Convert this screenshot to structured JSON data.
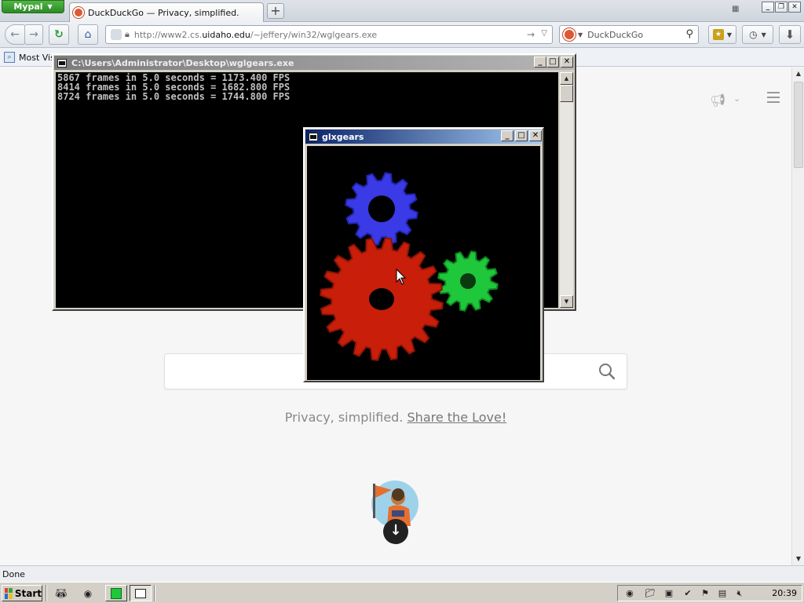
{
  "browser": {
    "app_button": "Mypal",
    "tab_title": "DuckDuckGo — Privacy, simplified.",
    "url": {
      "prefix": "http://www2.cs.",
      "domain": "uidaho.edu",
      "path": "/~jeffery/win32/wglgears.exe"
    },
    "search_placeholder": "DuckDuckGo",
    "bookmarks_bar_label": "Most Visi",
    "status": "Done"
  },
  "page": {
    "tagline": "Privacy, simplified.",
    "share_link": "Share the Love!"
  },
  "console": {
    "title": "C:\\Users\\Administrator\\Desktop\\wglgears.exe",
    "lines": [
      "5867 frames in 5.0 seconds = 1173.400 FPS",
      "8414 frames in 5.0 seconds = 1682.800 FPS",
      "8724 frames in 5.0 seconds = 1744.800 FPS"
    ]
  },
  "glx": {
    "title": "glxgears",
    "gear_colors": {
      "red": "#c81e0a",
      "green": "#1ec83a",
      "blue": "#3a3ae6"
    }
  },
  "taskbar": {
    "start_label": "Start",
    "clock": "20:39"
  },
  "colors": {
    "ddg_accent": "#de5833",
    "glx_title_start": "#0a246a",
    "console_title_start": "#7b7b7b"
  }
}
